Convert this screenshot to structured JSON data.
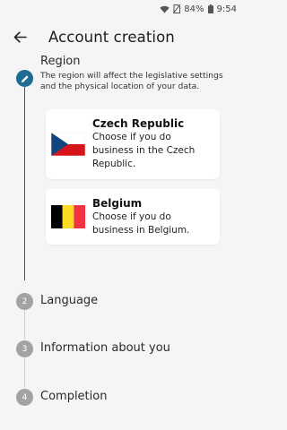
{
  "status_bar": {
    "battery": "84%",
    "time": "9:54"
  },
  "header": {
    "title": "Account creation"
  },
  "steps": [
    {
      "title": "Region",
      "description": "The region will affect the legislative settings and the physical location of your data."
    },
    {
      "number": "2",
      "title": "Language"
    },
    {
      "number": "3",
      "title": "Information about you"
    },
    {
      "number": "4",
      "title": "Completion"
    }
  ],
  "regions": [
    {
      "name": "Czech Republic",
      "description": "Choose if you do business in the Czech Republic."
    },
    {
      "name": "Belgium",
      "description": "Choose if you do business in Belgium."
    }
  ],
  "colors": {
    "accent": "#1f6b94",
    "inactive": "#a3a3a3",
    "background": "#f5f5f5"
  },
  "icons": {
    "back": "arrow-left-icon",
    "edit": "pencil-icon",
    "wifi": "wifi-icon",
    "battery": "battery-icon"
  }
}
